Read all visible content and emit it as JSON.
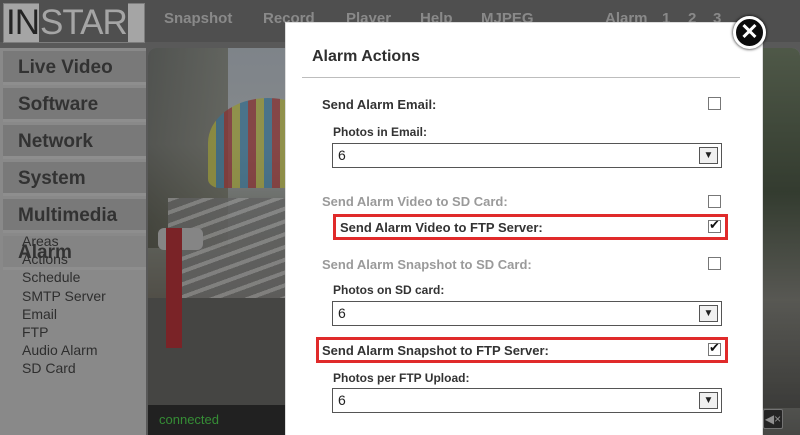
{
  "brand": {
    "part1": "IN",
    "part2": "STAR"
  },
  "topnav": {
    "items": [
      "Snapshot",
      "Record",
      "Player",
      "Help",
      "MJPEG"
    ],
    "alarm_label": "Alarm",
    "pages": [
      "1",
      "2",
      "3"
    ]
  },
  "sidebar": {
    "items": [
      "Live Video",
      "Software",
      "Network",
      "System",
      "Multimedia",
      "Alarm"
    ],
    "active": "Alarm",
    "subitems": [
      "Areas",
      "Actions",
      "Schedule",
      "SMTP Server",
      "Email",
      "FTP",
      "Audio Alarm",
      "SD Card"
    ]
  },
  "video": {
    "status": "connected",
    "mute_icon": "speaker-mute-icon"
  },
  "modal": {
    "title": "Alarm Actions",
    "close_icon": "close-icon",
    "rows": [
      {
        "label": "Send Alarm Email:",
        "checked": false,
        "disabled": false
      },
      {
        "label": "Send Alarm Video to SD Card:",
        "checked": false,
        "disabled": true
      },
      {
        "label": "Send Alarm Video to FTP Server:",
        "checked": true,
        "disabled": false
      },
      {
        "label": "Send Alarm Snapshot to SD Card:",
        "checked": false,
        "disabled": true
      },
      {
        "label": "Send Alarm Snapshot to FTP Server:",
        "checked": true,
        "disabled": false
      }
    ],
    "selects": [
      {
        "label": "Photos in Email:",
        "value": "6"
      },
      {
        "label": "Photos on SD card:",
        "value": "6"
      },
      {
        "label": "Photos per FTP Upload:",
        "value": "6"
      }
    ],
    "highlight_color": "#e02a2a"
  }
}
